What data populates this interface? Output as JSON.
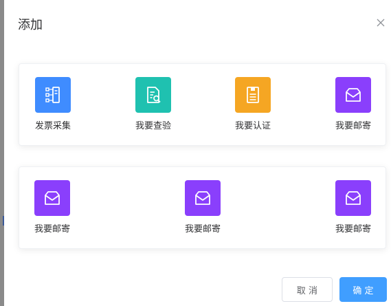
{
  "dialog": {
    "title": "添加",
    "close_icon": "close-icon"
  },
  "row1": [
    {
      "label": "发票采集",
      "icon": "invoice-collect-icon",
      "color": "#3f8cff"
    },
    {
      "label": "我要查验",
      "icon": "document-search-icon",
      "color": "#1fc1b0"
    },
    {
      "label": "我要认证",
      "icon": "document-list-icon",
      "color": "#f5a623"
    },
    {
      "label": "我要邮寄",
      "icon": "mail-tray-icon",
      "color": "#8a3ffc"
    }
  ],
  "row2": [
    {
      "label": "我要邮寄",
      "icon": "mail-tray-icon",
      "color": "#8a3ffc"
    },
    {
      "label": "我要邮寄",
      "icon": "mail-tray-icon",
      "color": "#8a3ffc"
    },
    {
      "label": "我要邮寄",
      "icon": "mail-tray-icon",
      "color": "#8a3ffc"
    }
  ],
  "footer": {
    "cancel_label": "取 消",
    "ok_label": "确 定"
  }
}
